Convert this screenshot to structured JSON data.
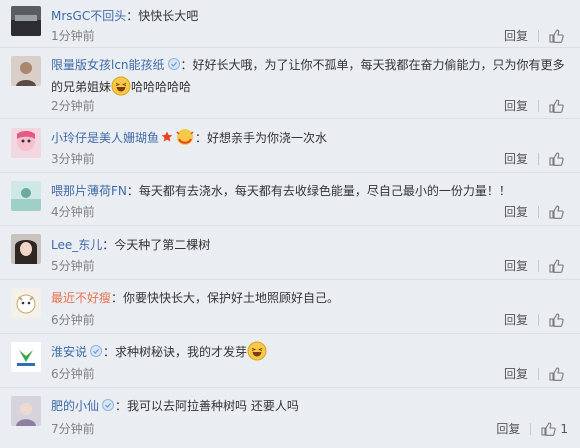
{
  "reply_label": "回复",
  "comments": [
    {
      "user": "MrsGC不回头",
      "text": "：快快长大吧",
      "time": "1分钟前",
      "likes": ""
    },
    {
      "user": "限量版女孩lcn能孩纸",
      "text": "：好好长大哦，为了让你不孤单，每天我都在奋力偷能力，只为你有更多的兄弟姐妹",
      "text2": "哈哈哈哈哈",
      "time": "2分钟前",
      "likes": ""
    },
    {
      "user": "小玲仔是美人姗瑚鱼",
      "text": "：好想亲手为你浇一次水",
      "time": "3分钟前",
      "likes": ""
    },
    {
      "user": "喂那片薄荷FN",
      "text": "：每天都有去浇水，每天都有去收绿色能量，尽自己最小的一份力量！！",
      "time": "4分钟前",
      "likes": ""
    },
    {
      "user": "Lee_东儿",
      "text": "：今天种了第二棵树",
      "time": "5分钟前",
      "likes": ""
    },
    {
      "user": "最近不好瘦",
      "text": "：你要快快长大，保护好土地照顾好自己。",
      "time": "6分钟前",
      "likes": ""
    },
    {
      "user": "淮安说",
      "text": "：求种树秘诀，我的才发芽",
      "time": "6分钟前",
      "likes": ""
    },
    {
      "user": "肥的小仙",
      "text": "：我可以去阿拉善种树吗 还要人吗",
      "time": "7分钟前",
      "likes": "1"
    }
  ]
}
